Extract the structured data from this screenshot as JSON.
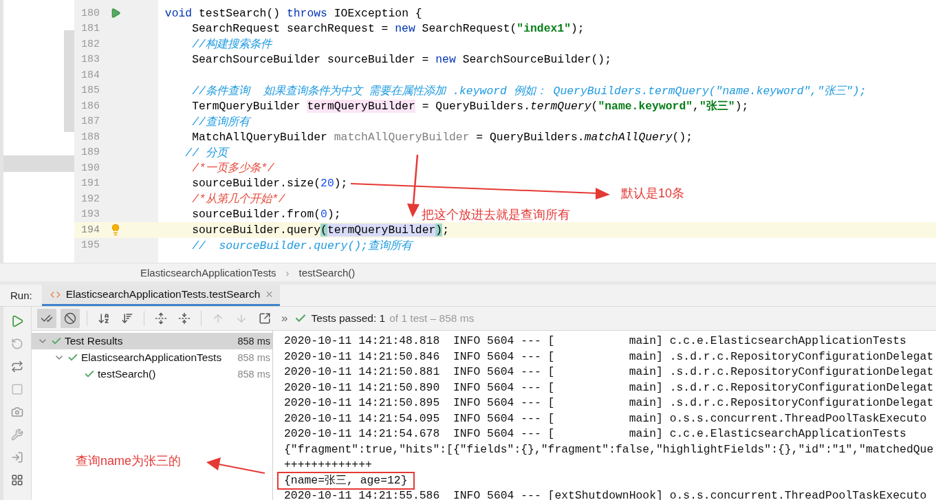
{
  "code_lines": [
    {
      "number": "180",
      "current": false,
      "run_icon": true,
      "segments": [
        {
          "kind": "keyword",
          "text": " void"
        },
        {
          "kind": "plain",
          "text": " testSearch() "
        },
        {
          "kind": "keyword",
          "text": "throws"
        },
        {
          "kind": "plain",
          "text": " IOException {"
        }
      ]
    },
    {
      "number": "181",
      "current": false,
      "segments": [
        {
          "kind": "plain",
          "text": "     SearchRequest searchRequest = "
        },
        {
          "kind": "keyword",
          "text": "new"
        },
        {
          "kind": "plain",
          "text": " SearchRequest("
        },
        {
          "kind": "string",
          "text": "\"index1\""
        },
        {
          "kind": "plain",
          "text": ");"
        }
      ]
    },
    {
      "number": "182",
      "current": false,
      "segments": [
        {
          "kind": "comment",
          "text": "     //构建搜索条件"
        }
      ]
    },
    {
      "number": "183",
      "current": false,
      "segments": [
        {
          "kind": "plain",
          "text": "     SearchSourceBuilder sourceBuilder = "
        },
        {
          "kind": "keyword",
          "text": "new"
        },
        {
          "kind": "plain",
          "text": " SearchSourceBuilder();"
        }
      ]
    },
    {
      "number": "184",
      "current": false
    },
    {
      "number": "185",
      "current": false,
      "segments": [
        {
          "kind": "comment",
          "text": "     //条件查询  如果查询条件为中文 需要在属性添加 .keyword 例如： QueryBuilders.termQuery(\"name.keyword\",\"张三\");"
        }
      ]
    },
    {
      "number": "186",
      "current": false,
      "segments": [
        {
          "kind": "plain",
          "text": "     TermQueryBuilder "
        },
        {
          "kind": "usage",
          "text": "termQueryBuilder"
        },
        {
          "kind": "plain",
          "text": " = QueryBuilders."
        },
        {
          "kind": "method",
          "text": "termQuery"
        },
        {
          "kind": "plain",
          "text": "("
        },
        {
          "kind": "string",
          "text": "\"name.keyword\""
        },
        {
          "kind": "plain",
          "text": ","
        },
        {
          "kind": "string",
          "text": "\"张三\""
        },
        {
          "kind": "plain",
          "text": ");"
        }
      ]
    },
    {
      "number": "187",
      "current": false,
      "segments": [
        {
          "kind": "comment",
          "text": "     //查询所有"
        }
      ]
    },
    {
      "number": "188",
      "current": false,
      "segments": [
        {
          "kind": "plain",
          "text": "     MatchAllQueryBuilder "
        },
        {
          "kind": "unused",
          "text": "matchAllQueryBuilder"
        },
        {
          "kind": "plain",
          "text": " = QueryBuilders."
        },
        {
          "kind": "method",
          "text": "matchAllQuery"
        },
        {
          "kind": "plain",
          "text": "();"
        }
      ]
    },
    {
      "number": "189",
      "current": false,
      "segments": [
        {
          "kind": "comment",
          "text": "    // 分页"
        }
      ]
    },
    {
      "number": "190",
      "current": false,
      "segments": [
        {
          "kind": "block",
          "text": "     /*一页多少条*/"
        }
      ]
    },
    {
      "number": "191",
      "current": false,
      "segments": [
        {
          "kind": "plain",
          "text": "     sourceBuilder.size("
        },
        {
          "kind": "number",
          "text": "20"
        },
        {
          "kind": "plain",
          "text": ");"
        }
      ]
    },
    {
      "number": "192",
      "current": false,
      "segments": [
        {
          "kind": "block",
          "text": "     /*从第几个开始*/"
        }
      ]
    },
    {
      "number": "193",
      "current": false,
      "segments": [
        {
          "kind": "plain",
          "text": "     sourceBuilder.from("
        },
        {
          "kind": "number",
          "text": "0"
        },
        {
          "kind": "plain",
          "text": ");"
        }
      ]
    },
    {
      "number": "194",
      "current": true,
      "bulb_icon": true,
      "segments": [
        {
          "kind": "plain",
          "text": "     sourceBuilder.query"
        },
        {
          "kind": "brace",
          "text": "("
        },
        {
          "kind": "selection",
          "text": "termQueryBuilder"
        },
        {
          "kind": "brace",
          "text": ")"
        },
        {
          "kind": "plain",
          "text": ";"
        }
      ]
    },
    {
      "number": "195",
      "current": false,
      "segments": [
        {
          "kind": "comment",
          "text": "     //  sourceBuilder.query();查询所有"
        }
      ]
    }
  ],
  "breadcrumb": [
    "ElasticsearchApplicationTests",
    "›",
    "testSearch()"
  ],
  "run": {
    "label": "Run:",
    "tabs": [
      {
        "label": "ElasticsearchApplicationTests.testSearch",
        "selected": true
      }
    ],
    "close": "×"
  },
  "toolbar": {
    "show_passed_selected": true,
    "show_ignored_selected": true,
    "prev_disabled": true,
    "next_disabled": true,
    "more": "»",
    "status": "Tests passed: 1",
    "status_detail": "of 1 test – 858 ms"
  },
  "tree": [
    {
      "label": "Test Results",
      "duration": "858 ms",
      "selected": true,
      "expanded": true,
      "children": [
        {
          "label": "ElasticsearchApplicationTests",
          "duration": "858 ms",
          "selected": false,
          "expanded": true,
          "children": [
            {
              "label": "testSearch()",
              "duration": "858 ms",
              "selected": false
            }
          ]
        }
      ]
    }
  ],
  "console": [
    {
      "kind": "log",
      "text": "2020-10-11 14:21:48.818  INFO 5604 --- [           main] c.c.e.ElasticsearchApplicationTests"
    },
    {
      "kind": "log",
      "text": "2020-10-11 14:21:50.846  INFO 5604 --- [           main] .s.d.r.c.RepositoryConfigurationDelegat"
    },
    {
      "kind": "log",
      "text": "2020-10-11 14:21:50.881  INFO 5604 --- [           main] .s.d.r.c.RepositoryConfigurationDelegat"
    },
    {
      "kind": "log",
      "text": "2020-10-11 14:21:50.890  INFO 5604 --- [           main] .s.d.r.c.RepositoryConfigurationDelegat"
    },
    {
      "kind": "log",
      "text": "2020-10-11 14:21:50.895  INFO 5604 --- [           main] .s.d.r.c.RepositoryConfigurationDelegat"
    },
    {
      "kind": "log",
      "text": "2020-10-11 14:21:54.095  INFO 5604 --- [           main] o.s.s.concurrent.ThreadPoolTaskExecuto"
    },
    {
      "kind": "log",
      "text": "2020-10-11 14:21:54.678  INFO 5604 --- [           main] c.c.e.ElasticsearchApplicationTests"
    },
    {
      "kind": "log",
      "text": "{\"fragment\":true,\"hits\":[{\"fields\":{},\"fragment\":false,\"highlightFields\":{},\"id\":\"1\",\"matchedQue"
    },
    {
      "kind": "log",
      "text": "+++++++++++++"
    },
    {
      "kind": "boxed",
      "text": "{name=张三, age=12}"
    },
    {
      "kind": "log",
      "text": "2020-10-11 14:21:55.586  INFO 5604 --- [extShutdownHook] o.s.s.concurrent.ThreadPoolTaskExecuto"
    }
  ],
  "annotations": [
    "默认是10条",
    "把这个放进去就是查询所有",
    "查询name为张三的"
  ]
}
